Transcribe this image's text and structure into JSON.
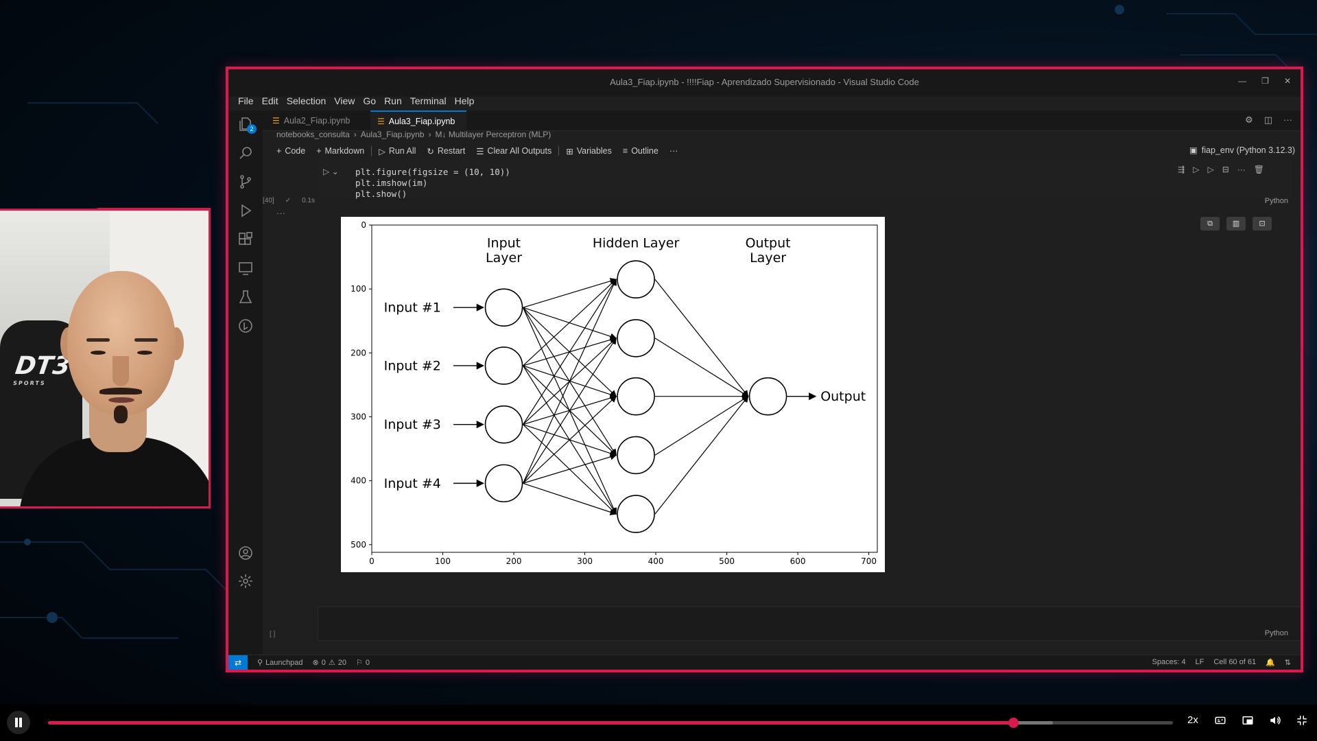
{
  "window": {
    "title": "Aula3_Fiap.ipynb - !!!!Fiap - Aprendizado Supervisionado - Visual Studio Code"
  },
  "menu": [
    "File",
    "Edit",
    "Selection",
    "View",
    "Go",
    "Run",
    "Terminal",
    "Help"
  ],
  "tabs": [
    {
      "label": "Aula2_Fiap.ipynb",
      "active": false
    },
    {
      "label": "Aula3_Fiap.ipynb",
      "active": true,
      "modified": true
    }
  ],
  "breadcrumb": [
    "notebooks_consulta",
    "Aula3_Fiap.ipynb",
    "M↓ Multilayer Perceptron (MLP)"
  ],
  "toolbar": {
    "code": "Code",
    "markdown": "Markdown",
    "run_all": "Run All",
    "restart": "Restart",
    "clear_outputs": "Clear All Outputs",
    "variables": "Variables",
    "outline": "Outline",
    "more": "···"
  },
  "kernel": "fiap_env (Python 3.12.3)",
  "cell": {
    "code_lines": [
      "plt.figure(figsize = (10, 10))",
      "plt.imshow(im)",
      "plt.show()"
    ],
    "exec_count": "[40]",
    "duration": "0.1s",
    "language": "Python"
  },
  "empty_cell": {
    "bracket": "[ ]",
    "language": "Python"
  },
  "statusbar": {
    "launchpad": "Launchpad",
    "errors": "0",
    "warnings": "20",
    "ports": "0",
    "spaces": "Spaces: 4",
    "eol": "LF",
    "cell_pos": "Cell 60 of 61"
  },
  "figure": {
    "layer_titles": [
      "Input\nLayer",
      "Hidden Layer",
      "Output\nLayer"
    ],
    "inputs": [
      "Input #1",
      "Input #2",
      "Input #3",
      "Input #4"
    ],
    "output": "Output",
    "x_ticks": [
      "0",
      "100",
      "200",
      "300",
      "400",
      "500",
      "600",
      "700"
    ],
    "y_ticks": [
      "0",
      "100",
      "200",
      "300",
      "400",
      "500"
    ]
  },
  "webcam": {
    "chair_logo": "DT3",
    "chair_sub": "SPORTS"
  },
  "player": {
    "progress": 0.858,
    "buffered": 0.893,
    "speed": "2x"
  },
  "colors": {
    "accent": "#d91a4e",
    "vscode_blue": "#0078d4"
  }
}
